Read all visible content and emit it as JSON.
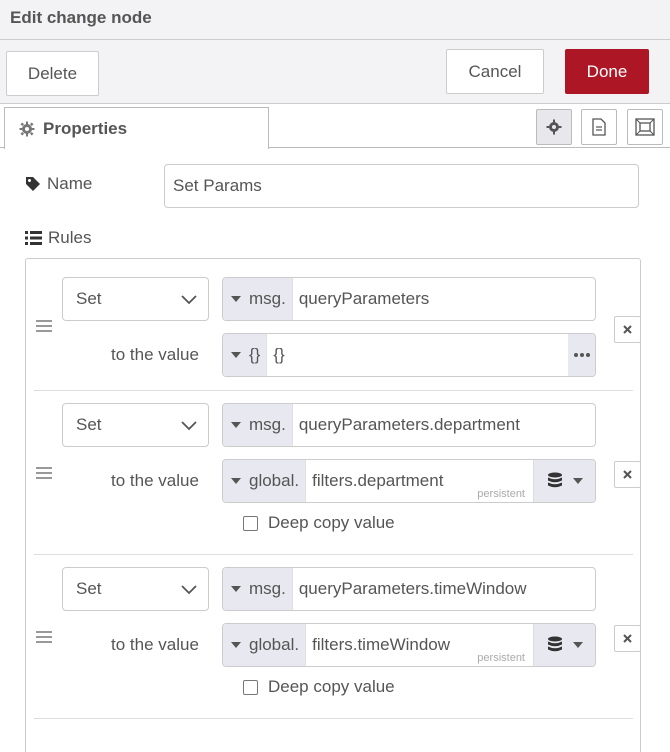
{
  "header": {
    "title": "Edit change node"
  },
  "toolbar": {
    "delete_label": "Delete",
    "cancel_label": "Cancel",
    "done_label": "Done"
  },
  "tabs": {
    "properties_label": "Properties"
  },
  "form": {
    "name_label": "Name",
    "name_value": "Set Params",
    "rules_label": "Rules"
  },
  "rules": [
    {
      "action": "Set",
      "target_type": "msg.",
      "target_value": "queryParameters",
      "to_label": "to the value",
      "value_type": "{}",
      "value": "{}"
    },
    {
      "action": "Set",
      "target_type": "msg.",
      "target_value": "queryParameters.department",
      "to_label": "to the value",
      "value_type": "global.",
      "value": "filters.department",
      "store": "persistent",
      "deep_copy_label": "Deep copy value",
      "deep_copy_checked": false
    },
    {
      "action": "Set",
      "target_type": "msg.",
      "target_value": "queryParameters.timeWindow",
      "to_label": "to the value",
      "value_type": "global.",
      "value": "filters.timeWindow",
      "store": "persistent",
      "deep_copy_label": "Deep copy value",
      "deep_copy_checked": false
    }
  ],
  "colors": {
    "done_button": "#ad1625",
    "type_button_bg": "#e8e8f0",
    "header_bg": "#f3f3f6"
  }
}
